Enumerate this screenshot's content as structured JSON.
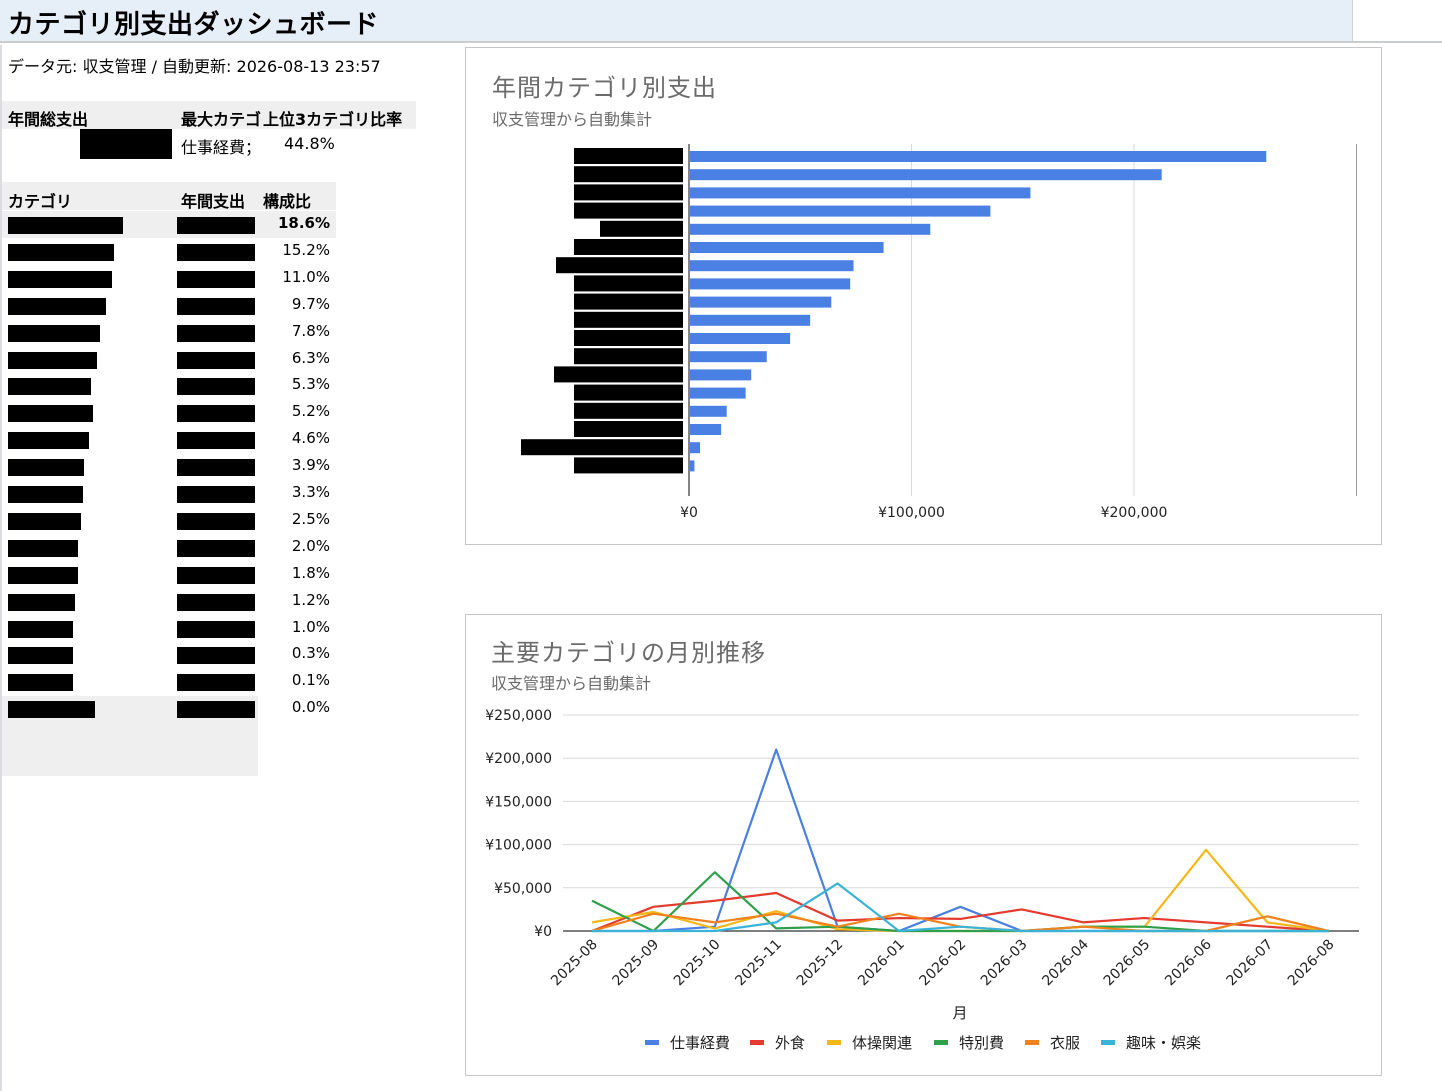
{
  "page": {
    "title": "カテゴリ別支出ダッシュボード",
    "source_line": "データ元: 収支管理 / 自動更新: 2026-08-13 23:57"
  },
  "kpi": {
    "total_label": "年間総支出",
    "max_label": "最大カテゴリ",
    "top3_label": "上位3カテゴリ比率",
    "max_value": "仕事経費；",
    "top3_value": "44.8%"
  },
  "table": {
    "col_category": "カテゴリ",
    "col_annual": "年間支出",
    "col_share": "構成比",
    "shares": [
      "18.6%",
      "15.2%",
      "11.0%",
      "9.7%",
      "7.8%",
      "6.3%",
      "5.3%",
      "5.2%",
      "4.6%",
      "3.9%",
      "3.3%",
      "2.5%",
      "2.0%",
      "1.8%",
      "1.2%",
      "1.0%",
      "0.3%",
      "0.1%",
      "0.0%"
    ]
  },
  "colors": {
    "bar": "#4a7fe3",
    "series": [
      "#4a7fe3",
      "#e53a2e",
      "#f4b818",
      "#2ea04c",
      "#f0821d",
      "#3ab3d6"
    ]
  },
  "chart_data": [
    {
      "type": "bar",
      "orientation": "horizontal",
      "title": "年間カテゴリ別支出",
      "subtitle": "収支管理から自動集計",
      "values": [
        259000,
        212000,
        153000,
        135000,
        108000,
        87000,
        73500,
        72000,
        63500,
        54000,
        45000,
        34500,
        27500,
        25000,
        16500,
        14000,
        4500,
        2000
      ],
      "xlim": [
        0,
        300000
      ],
      "xticks": [
        "¥0",
        "¥100,000",
        "¥200,000"
      ],
      "grid": true
    },
    {
      "type": "line",
      "title": "主要カテゴリの月別推移",
      "subtitle": "収支管理から自動集計",
      "xlabel": "月",
      "x": [
        "2025-08",
        "2025-09",
        "2025-10",
        "2025-11",
        "2025-12",
        "2026-01",
        "2026-02",
        "2026-03",
        "2026-04",
        "2026-05",
        "2026-06",
        "2026-07",
        "2026-08"
      ],
      "yticks": [
        "¥0",
        "¥50,000",
        "¥100,000",
        "¥150,000",
        "¥200,000",
        "¥250,000"
      ],
      "ylim": [
        0,
        250000
      ],
      "legend_position": "bottom",
      "series": [
        {
          "name": "仕事経費",
          "values": [
            0,
            0,
            5000,
            210000,
            5000,
            0,
            28000,
            0,
            0,
            0,
            0,
            0,
            0
          ]
        },
        {
          "name": "外食",
          "values": [
            0,
            28000,
            35000,
            44000,
            12000,
            15000,
            14000,
            25000,
            10000,
            15000,
            10000,
            5000,
            0
          ]
        },
        {
          "name": "体操関連",
          "values": [
            10000,
            22000,
            3000,
            23000,
            2000,
            0,
            0,
            0,
            5000,
            5000,
            94000,
            10000,
            0
          ]
        },
        {
          "name": "特別費",
          "values": [
            35000,
            0,
            68000,
            3000,
            5000,
            0,
            0,
            0,
            5000,
            5000,
            0,
            0,
            0
          ]
        },
        {
          "name": "衣服",
          "values": [
            0,
            20000,
            10000,
            20000,
            5000,
            20000,
            5000,
            0,
            5000,
            0,
            0,
            17000,
            0
          ]
        },
        {
          "name": "趣味・娯楽",
          "values": [
            0,
            0,
            0,
            10000,
            55000,
            0,
            5000,
            0,
            0,
            0,
            0,
            0,
            0
          ]
        }
      ]
    }
  ]
}
